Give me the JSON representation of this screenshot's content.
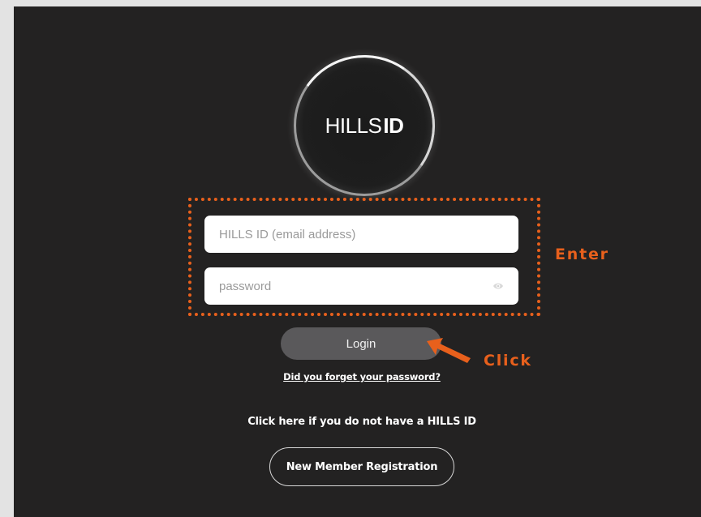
{
  "logo": {
    "text_regular": "HILLS",
    "text_bold": "ID"
  },
  "login_form": {
    "email_placeholder": "HILLS ID (email address)",
    "password_placeholder": "password",
    "login_label": "Login",
    "forgot_password_link": "Did you forget your password?"
  },
  "registration": {
    "prompt": "Click here if you do not have a HILLS ID",
    "button_label": "New Member Registration"
  },
  "annotations": {
    "enter_label": "Enter",
    "click_label": "Click",
    "accent_color": "#e8601c"
  },
  "colors": {
    "panel_background": "#232222",
    "page_background": "#e3e3e3",
    "login_button": "#5a595b"
  }
}
